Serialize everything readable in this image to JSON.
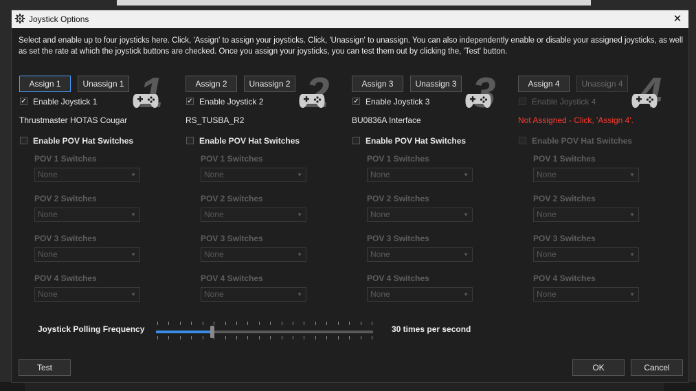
{
  "window": {
    "title": "Joystick Options",
    "close_glyph": "✕"
  },
  "intro_text": "Select and enable up to four joysticks here.  Click, 'Assign' to assign your joysticks.  Click, 'Unassign' to unassign.  You can also independently enable or disable your assigned joysticks, as well as set the rate at which the joystick buttons are checked.  Once you assign your joysticks, you can test them out by clicking the, 'Test' button.",
  "joysticks": [
    {
      "number": "1",
      "assign_label": "Assign 1",
      "unassign_label": "Unassign 1",
      "unassign_enabled": true,
      "enable_label": "Enable Joystick 1",
      "enabled_checked": true,
      "enable_disabled": false,
      "device": "Thrustmaster HOTAS Cougar",
      "device_error": false,
      "pov_label": "Enable POV Hat Switches",
      "pov_checked": false,
      "pov_disabled": false
    },
    {
      "number": "2",
      "assign_label": "Assign 2",
      "unassign_label": "Unassign 2",
      "unassign_enabled": true,
      "enable_label": "Enable Joystick 2",
      "enabled_checked": true,
      "enable_disabled": false,
      "device": "RS_TUSBA_R2",
      "device_error": false,
      "pov_label": "Enable POV Hat Switches",
      "pov_checked": false,
      "pov_disabled": false
    },
    {
      "number": "3",
      "assign_label": "Assign 3",
      "unassign_label": "Unassign 3",
      "unassign_enabled": true,
      "enable_label": "Enable Joystick 3",
      "enabled_checked": true,
      "enable_disabled": false,
      "device": "BU0836A Interface",
      "device_error": false,
      "pov_label": "Enable POV Hat Switches",
      "pov_checked": false,
      "pov_disabled": false
    },
    {
      "number": "4",
      "assign_label": "Assign 4",
      "unassign_label": "Unassign 4",
      "unassign_enabled": false,
      "enable_label": "Enable Joystick 4",
      "enabled_checked": false,
      "enable_disabled": true,
      "device": "Not Assigned - Click, 'Assign 4'.",
      "device_error": true,
      "pov_label": "Enable POV Hat Switches",
      "pov_checked": false,
      "pov_disabled": true
    }
  ],
  "pov_switches": [
    {
      "label": "POV 1 Switches",
      "value": "None"
    },
    {
      "label": "POV 2 Switches",
      "value": "None"
    },
    {
      "label": "POV 3 Switches",
      "value": "None"
    },
    {
      "label": "POV 4 Switches",
      "value": "None"
    }
  ],
  "polling": {
    "label": "Joystick Polling Frequency",
    "value_text": "30 times per second",
    "slider_fraction": 0.26,
    "tick_count": 20
  },
  "footer": {
    "test_label": "Test",
    "ok_label": "OK",
    "cancel_label": "Cancel"
  },
  "colors": {
    "accent": "#3a8ee6",
    "focus_border": "#4aa0ff",
    "error": "#ff3b30"
  }
}
